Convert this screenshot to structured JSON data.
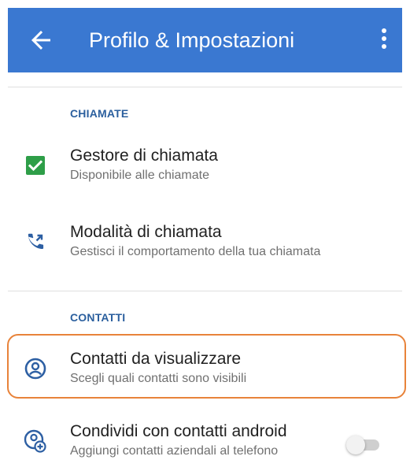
{
  "appbar": {
    "title": "Profilo & Impostazioni",
    "back_icon": "arrow-back-icon",
    "menu_icon": "more-vert-icon",
    "color": "#3a78d1"
  },
  "sections": {
    "calls": "CHIAMATE",
    "contacts": "CONTATTI"
  },
  "items": {
    "call_manager": {
      "title": "Gestore di chiamata",
      "subtitle": "Disponibile alle chiamate",
      "icon": "checkbox-checked-icon",
      "checked": true
    },
    "call_mode": {
      "title": "Modalità di chiamata",
      "subtitle": "Gestisci il comportamento della tua chiamata",
      "icon": "call-forward-icon"
    },
    "contacts_display": {
      "title": "Contatti da visualizzare",
      "subtitle": "Scegli quali contatti sono visibili",
      "icon": "account-circle-icon"
    },
    "share_contacts": {
      "title": "Condividi con contatti android",
      "subtitle": "Aggiungi contatti aziendali al telefono",
      "icon": "contact-add-icon",
      "toggle_on": false
    }
  },
  "colors": {
    "accent": "#2b5f9e",
    "check": "#2e9e48",
    "highlight": "#e8833a"
  }
}
